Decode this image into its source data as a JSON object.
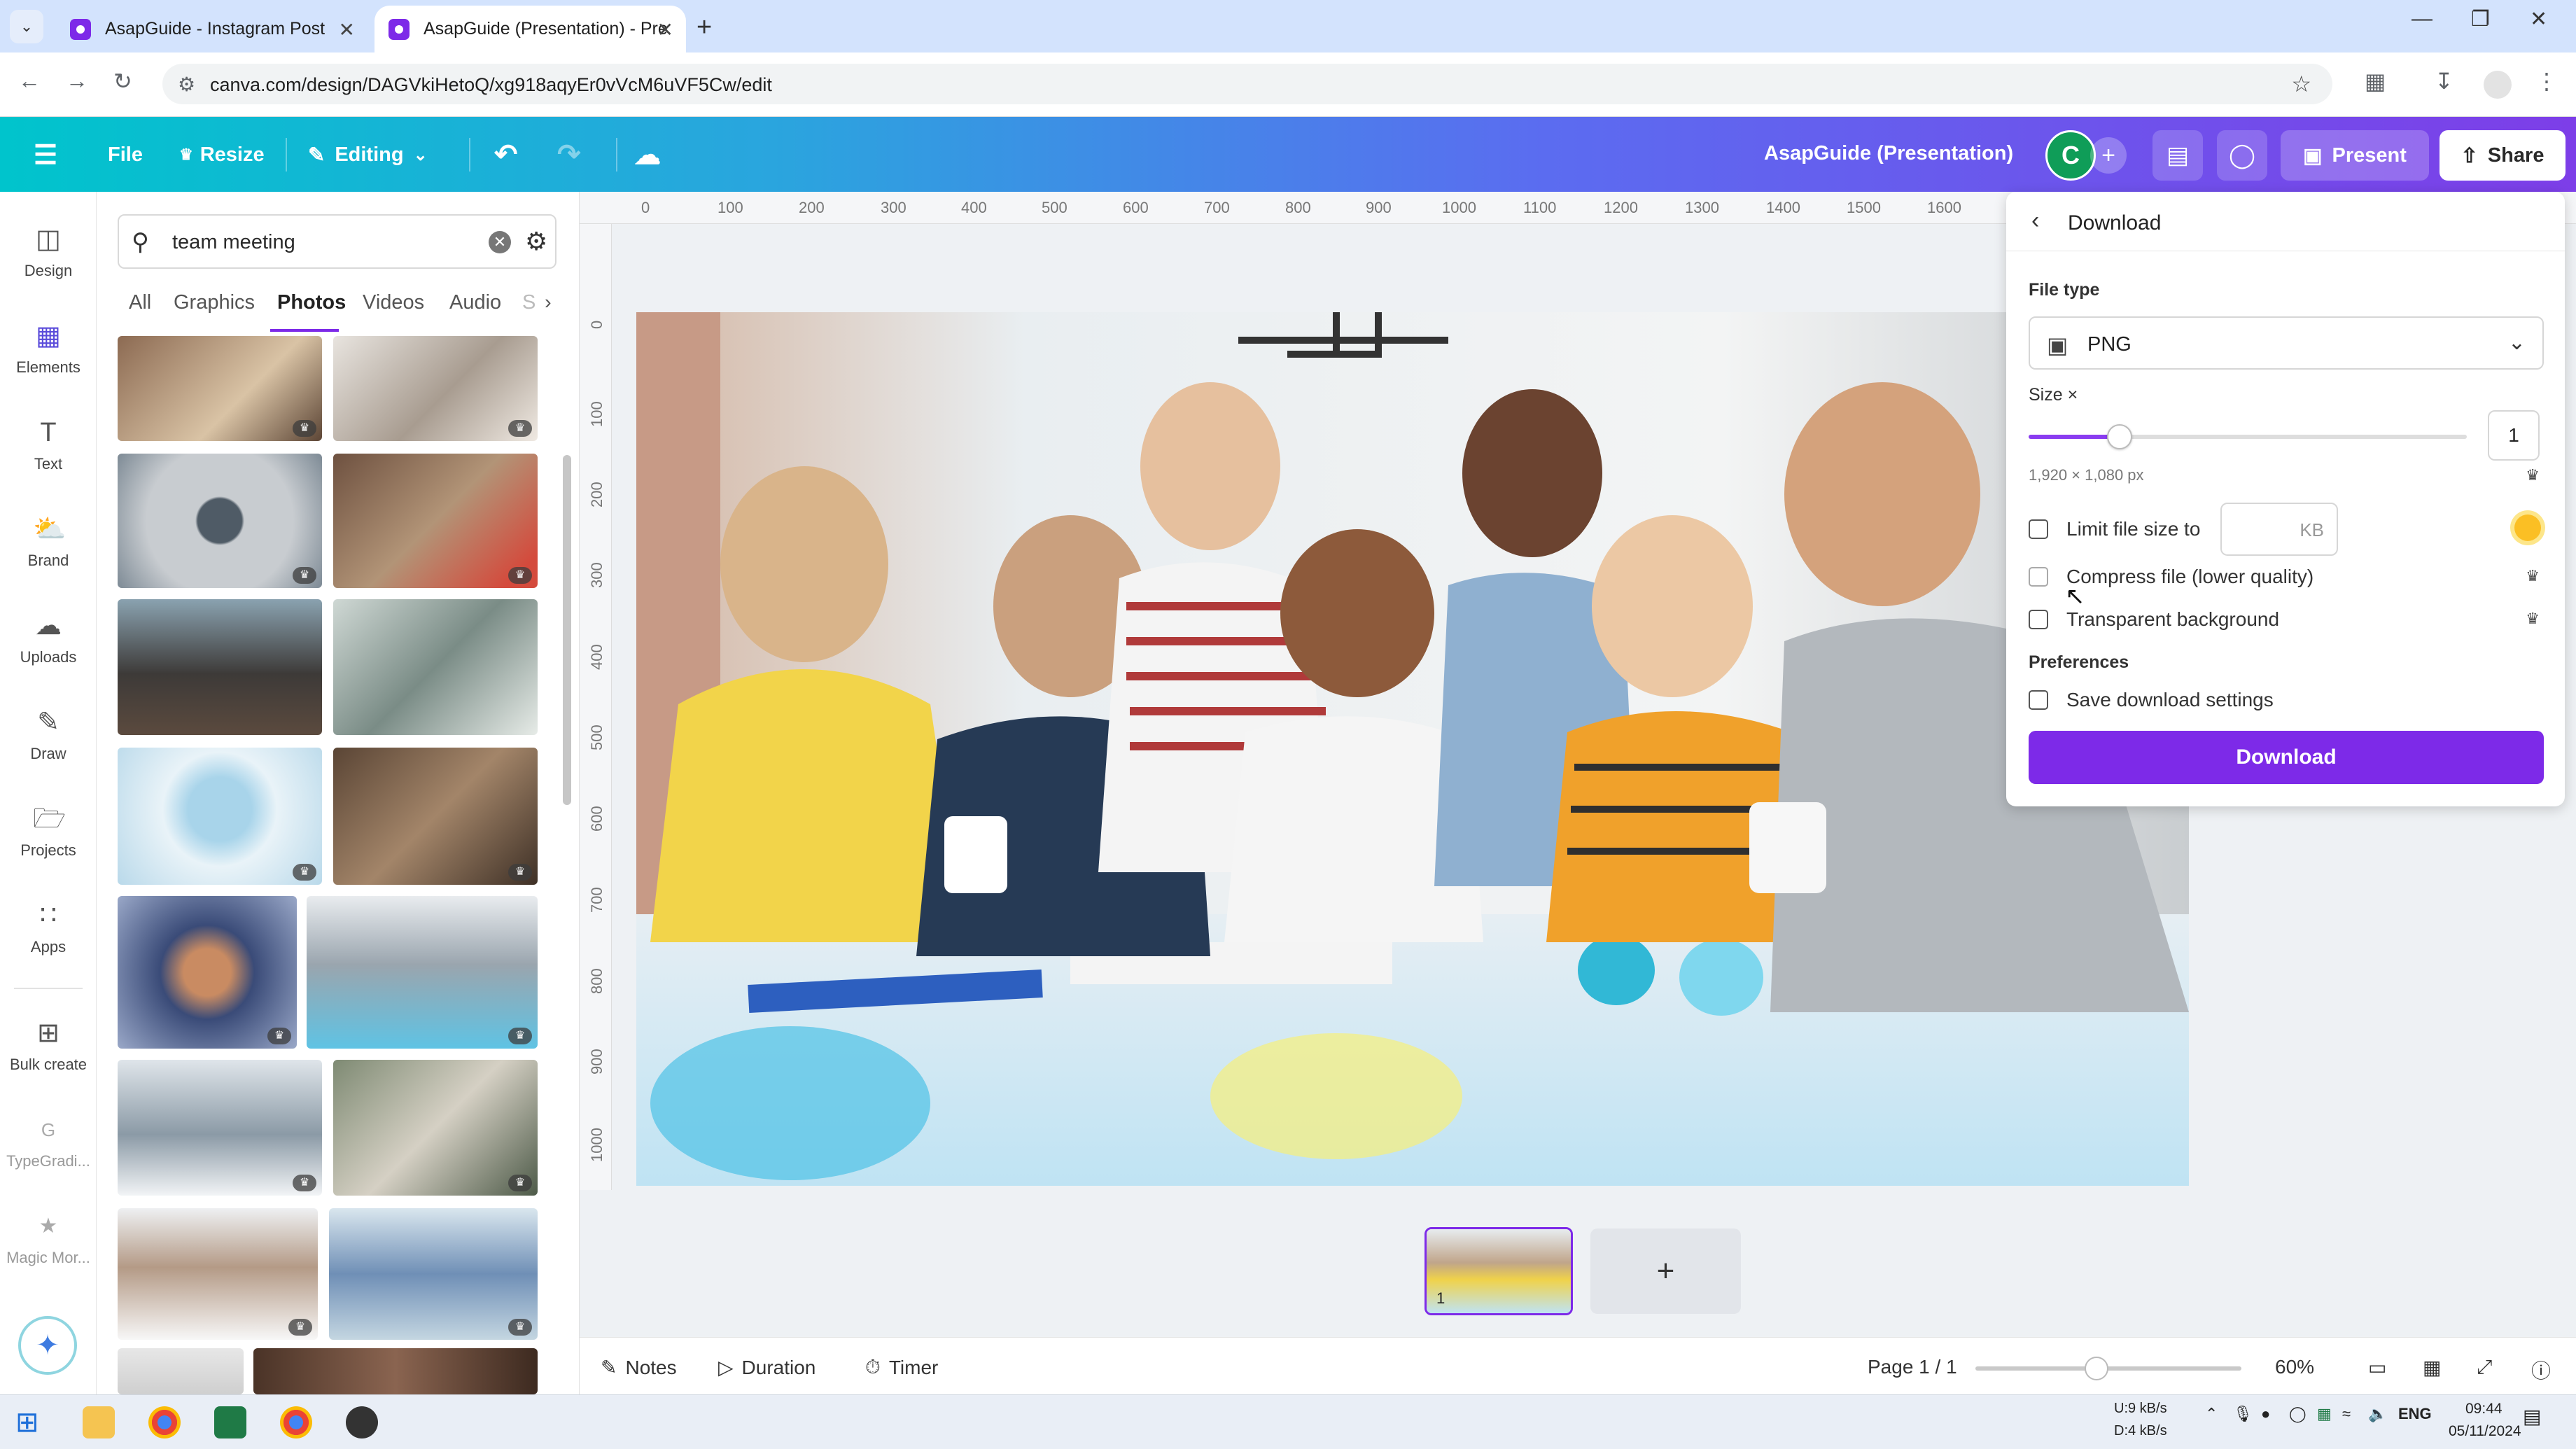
{
  "browser": {
    "tabs": [
      {
        "title": "AsapGuide - Instagram Post",
        "active": false
      },
      {
        "title": "AsapGuide (Presentation) - Pre",
        "active": true
      }
    ],
    "url": "canva.com/design/DAGVkiHetoQ/xg918aqyEr0vVcM6uVF5Cw/edit"
  },
  "header": {
    "file_label": "File",
    "resize_label": "Resize",
    "editing_label": "Editing",
    "doc_title": "AsapGuide (Presentation)",
    "avatar_letter": "C",
    "present_label": "Present",
    "share_label": "Share"
  },
  "rail": {
    "items": [
      {
        "label": "Design",
        "icon": "layout-icon"
      },
      {
        "label": "Elements",
        "icon": "shapes-icon"
      },
      {
        "label": "Text",
        "icon": "text-icon"
      },
      {
        "label": "Brand",
        "icon": "brand-icon"
      },
      {
        "label": "Uploads",
        "icon": "cloud-upload-icon"
      },
      {
        "label": "Draw",
        "icon": "pen-icon"
      },
      {
        "label": "Projects",
        "icon": "folder-icon"
      },
      {
        "label": "Apps",
        "icon": "apps-icon"
      },
      {
        "label": "Bulk create",
        "icon": "bulk-create-icon"
      },
      {
        "label": "TypeGradi...",
        "icon": "typegradient-icon"
      },
      {
        "label": "Magic Mor...",
        "icon": "magic-morph-icon"
      }
    ]
  },
  "panel": {
    "search_value": "team meeting",
    "categories": [
      "All",
      "Graphics",
      "Photos",
      "Videos",
      "Audio",
      "S"
    ],
    "active_category": "Photos"
  },
  "ruler": {
    "h_ticks": [
      "0",
      "100",
      "200",
      "300",
      "400",
      "500",
      "600",
      "700",
      "800",
      "900",
      "1000",
      "1100",
      "1200",
      "1300",
      "1400",
      "1500",
      "1600"
    ],
    "v_ticks": [
      "0",
      "100",
      "200",
      "300",
      "400",
      "500",
      "600",
      "700",
      "800",
      "900",
      "1000"
    ]
  },
  "bottom": {
    "notes_label": "Notes",
    "duration_label": "Duration",
    "timer_label": "Timer",
    "page_label": "Page 1 / 1",
    "zoom_label": "60%",
    "page_number": "1"
  },
  "download": {
    "title": "Download",
    "file_type_label": "File type",
    "file_type_value": "PNG",
    "size_label": "Size ×",
    "size_value": "1",
    "dims": "1,920 × 1,080 px",
    "limit_label": "Limit file size to",
    "kb_label": "KB",
    "compress_label": "Compress file (lower quality)",
    "transparent_label": "Transparent background",
    "preferences_label": "Preferences",
    "save_settings_label": "Save download settings",
    "button_label": "Download"
  },
  "taskbar": {
    "net_up": "9 kB/s",
    "net_down": "4 kB/s",
    "net_u": "U:",
    "net_d": "D:",
    "lang": "ENG",
    "time": "09:44",
    "date": "05/11/2024"
  },
  "colors": {
    "brand_purple": "#7d2ae8",
    "header_start": "#00c4cc",
    "header_end": "#7d3ee8",
    "avatar_green": "#0f9d58"
  }
}
